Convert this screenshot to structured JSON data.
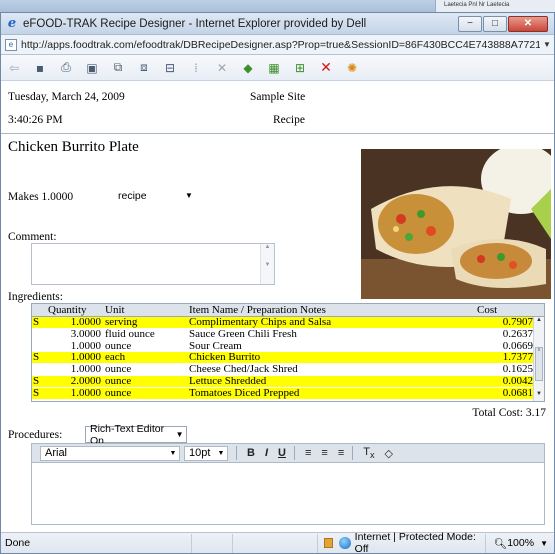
{
  "background": {
    "right_panel_text": "Laetecia      Pnl Nr Laetecia"
  },
  "window": {
    "title": "eFOOD-TRAK Recipe Designer - Internet Explorer provided by Dell",
    "minimize": "−",
    "maximize": "□",
    "close": "✕"
  },
  "address": {
    "url": "http://apps.foodtrak.com/efoodtrak/DBRecipeDesigner.asp?Prop=true&SessionID=86F430BCC4E743888A7721B0B57E34CD&recipeID=164"
  },
  "toolbar": {
    "icons": [
      "back-icon",
      "save-icon",
      "print-icon",
      "properties-icon",
      "copy-icon",
      "paste-icon",
      "cut-icon",
      "copy-row-icon",
      "delete-row-icon",
      "scale-icon",
      "calculator-icon",
      "export-icon",
      "close-icon",
      "nutrition-icon"
    ]
  },
  "header": {
    "date": "Tuesday, March 24, 2009",
    "site": "Sample Site",
    "time": "3:40:26 PM",
    "type": "Recipe"
  },
  "recipe": {
    "name": "Chicken Burrito Plate",
    "makes_label": "Makes 1.0000",
    "unit": "recipe",
    "comment_label": "Comment:",
    "comment_value": ""
  },
  "ingredients": {
    "label": "Ingredients:",
    "columns": [
      "Quantity",
      "Unit",
      "Item Name / Preparation Notes",
      "Cost"
    ],
    "rows": [
      {
        "flag": "S",
        "qty": "1.0000",
        "unit": "serving",
        "item": "Complimentary Chips and Salsa",
        "cost": "0.7907",
        "highlight": true
      },
      {
        "flag": "",
        "qty": "3.0000",
        "unit": "fluid ounce",
        "item": "Sauce Green Chili Fresh",
        "cost": "0.2637",
        "highlight": false
      },
      {
        "flag": "",
        "qty": "1.0000",
        "unit": "ounce",
        "item": "Sour Cream",
        "cost": "0.0669",
        "highlight": false
      },
      {
        "flag": "S",
        "qty": "1.0000",
        "unit": "each",
        "item": "Chicken Burrito",
        "cost": "1.7377",
        "highlight": true
      },
      {
        "flag": "",
        "qty": "1.0000",
        "unit": "ounce",
        "item": "Cheese Ched/Jack Shred",
        "cost": "0.1625",
        "highlight": false
      },
      {
        "flag": "S",
        "qty": "2.0000",
        "unit": "ounce",
        "item": "Lettuce Shredded",
        "cost": "0.0042",
        "highlight": true
      },
      {
        "flag": "S",
        "qty": "1.0000",
        "unit": "ounce",
        "item": "Tomatoes Diced Prepped",
        "cost": "0.0681",
        "highlight": true
      }
    ],
    "total_cost": "Total Cost: 3.17"
  },
  "procedures": {
    "label": "Procedures:",
    "mode": "Rich-Text Editor On",
    "font": "Arial",
    "size": "10pt",
    "bold": "B",
    "italic": "I",
    "underline": "U",
    "text": ""
  },
  "status": {
    "left": "Done",
    "zone": "Internet | Protected Mode: Off",
    "zoom": "100%"
  }
}
